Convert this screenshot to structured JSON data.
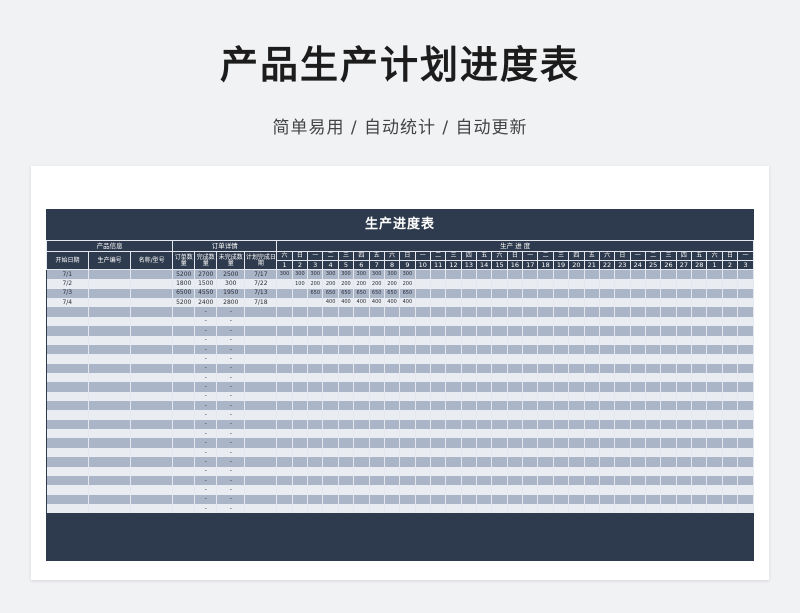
{
  "page": {
    "title": "产品生产计划进度表",
    "subtitle": "简单易用 / 自动统计 / 自动更新"
  },
  "sheet": {
    "title": "生产进度表",
    "groups": {
      "product_info": "产品信息",
      "order_details": "订单详情",
      "progress": "生产 进 度"
    },
    "columns": {
      "start_date": "开始日期",
      "product_code": "生产编号",
      "name_model": "名称/型号",
      "order_qty": "订单数量",
      "done_qty": "完成数量",
      "undone_qty": "未完成数量",
      "plan_date": "计划完成日期"
    },
    "weekdays": [
      "六",
      "日",
      "一",
      "二",
      "三",
      "四",
      "五",
      "六",
      "日",
      "一",
      "二",
      "三",
      "四",
      "五",
      "六",
      "日",
      "一",
      "二",
      "三",
      "四",
      "五",
      "六",
      "日",
      "一",
      "二",
      "三",
      "四",
      "五",
      "六",
      "日",
      "一"
    ],
    "days": [
      "1",
      "2",
      "3",
      "4",
      "5",
      "6",
      "7",
      "8",
      "9",
      "10",
      "11",
      "12",
      "13",
      "14",
      "15",
      "16",
      "17",
      "18",
      "19",
      "20",
      "21",
      "22",
      "23",
      "24",
      "25",
      "26",
      "27",
      "28",
      "1",
      "2",
      "3"
    ],
    "rows": [
      {
        "start": "7/1",
        "code": "",
        "name": "",
        "order": "5200",
        "done": "2700",
        "undone": "2500",
        "plan": "7/17",
        "progress": [
          "300",
          "300",
          "300",
          "300",
          "300",
          "300",
          "300",
          "300",
          "300"
        ]
      },
      {
        "start": "7/2",
        "code": "",
        "name": "",
        "order": "1800",
        "done": "1500",
        "undone": "300",
        "plan": "7/22",
        "progress": [
          "",
          "100",
          "200",
          "200",
          "200",
          "200",
          "200",
          "200",
          "200"
        ]
      },
      {
        "start": "7/3",
        "code": "",
        "name": "",
        "order": "6500",
        "done": "4550",
        "undone": "1950",
        "plan": "7/13",
        "progress": [
          "",
          "",
          "650",
          "650",
          "650",
          "650",
          "650",
          "650",
          "650"
        ]
      },
      {
        "start": "7/4",
        "code": "",
        "name": "",
        "order": "5200",
        "done": "2400",
        "undone": "2800",
        "plan": "7/18",
        "progress": [
          "",
          "",
          "",
          "400",
          "400",
          "400",
          "400",
          "400",
          "400"
        ]
      }
    ],
    "empty_rows": 22,
    "empty_placeholder": "-"
  },
  "colors": {
    "header_bg": "#2e3a4d",
    "stripe_dark": "#aab5c8",
    "stripe_light": "#e9ecf1",
    "page_bg": "#f1f2f4"
  }
}
